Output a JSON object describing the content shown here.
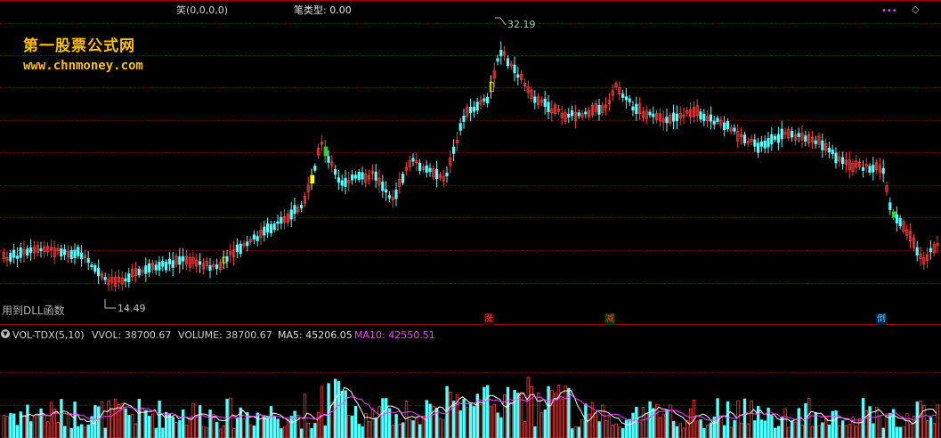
{
  "header": {
    "formula_label": "笑(0,0,0,0)",
    "stroke_label": "笔类型: 0.00",
    "menu_icon": "dots-icon",
    "nav_icon": "diamond-icon"
  },
  "watermark": {
    "site_name": "第一股票公式网",
    "site_url": "www.chnmoney.com"
  },
  "price_panel": {
    "high_label": "32.19",
    "low_label": "14.49",
    "dll_note": "用到DLL函数",
    "signals": [
      {
        "label": "涨",
        "color": "#ff4040",
        "bg": "#400000"
      },
      {
        "label": "减",
        "color": "#ff4040",
        "bg": "#003300"
      },
      {
        "label": "倒",
        "color": "#60c0ff",
        "bg": "#002040"
      }
    ]
  },
  "volume_panel": {
    "collapse_icon": "chevron-down-icon",
    "indicator_name": "VOL-TDX(5,10)",
    "vvol_label": "VVOL: 38700.67",
    "volume_label": "VOLUME: 38700.67",
    "ma5_label": "MA5: 45206.05",
    "ma10_label": "MA10: 42550.51"
  },
  "colors": {
    "up": "#ff3b3b",
    "down": "#54ffff",
    "highlight": "#ffff00",
    "green": "#33cc33",
    "grid": "#800000",
    "ma5": "#ffffff",
    "ma10": "#ff40ff",
    "label": "#00e0e0",
    "watermark": "#ffc000"
  }
}
